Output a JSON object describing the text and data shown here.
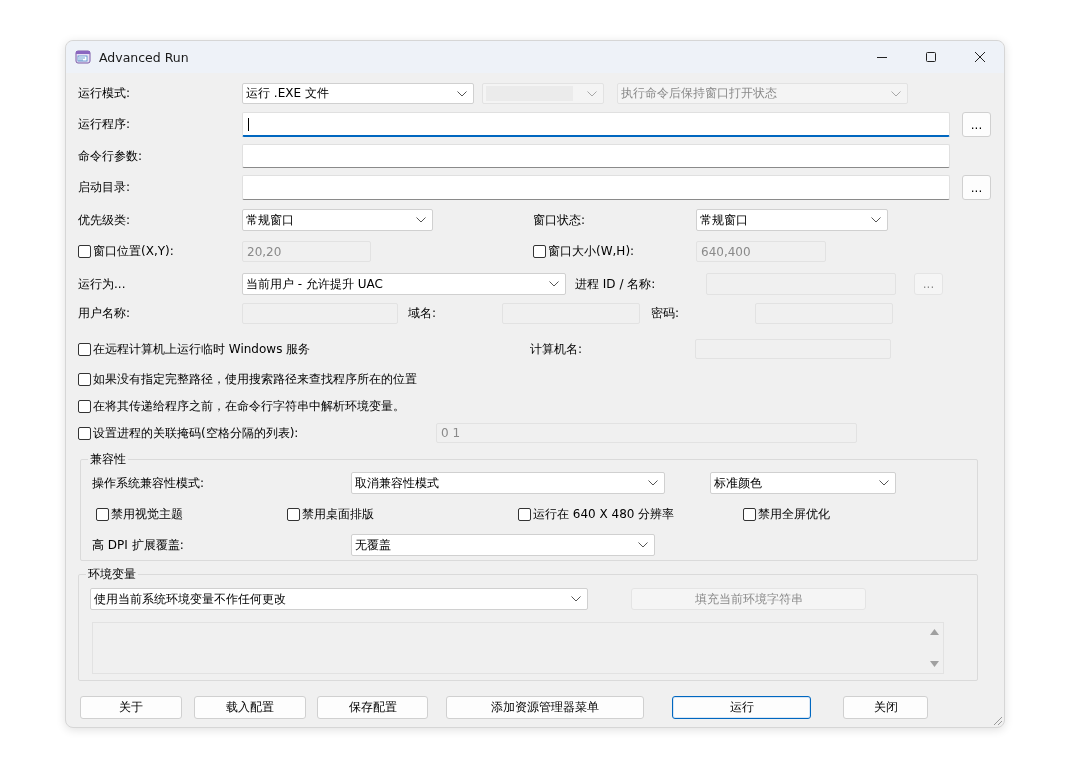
{
  "window": {
    "title": "Advanced Run"
  },
  "run_mode": {
    "label": "运行模式:",
    "mode": {
      "value": "运行 .EXE 文件",
      "disabled": false
    },
    "secondary": {
      "disabled": true
    },
    "window_option": {
      "value": "执行命令后保持窗口打开状态",
      "disabled": true
    }
  },
  "program": {
    "label": "运行程序:",
    "focused": true,
    "disabled": false,
    "browse": {
      "label": "...",
      "disabled": false
    }
  },
  "arguments": {
    "label": "命令行参数:",
    "focused": false,
    "disabled": false
  },
  "start_directory": {
    "label": "启动目录:",
    "focused": false,
    "disabled": false,
    "browse": {
      "label": "...",
      "disabled": false
    }
  },
  "priority": {
    "label": "优先级类:",
    "value": "常规窗口",
    "disabled": false
  },
  "window_state": {
    "label": "窗口状态:",
    "value": "常规窗口",
    "disabled": false
  },
  "window_position": {
    "label": "窗口位置(X,Y):",
    "checked": false,
    "value": "20,20",
    "disabled": true
  },
  "window_size": {
    "label": "窗口大小(W,H):",
    "checked": false,
    "value": "640,400",
    "disabled": true
  },
  "run_as": {
    "label": "运行为...",
    "value": "当前用户 - 允许提升 UAC",
    "disabled": false
  },
  "process": {
    "label": "进程 ID / 名称:",
    "disabled": true,
    "browse": {
      "label": "...",
      "disabled": true
    }
  },
  "user_name": {
    "label": "用户名称:",
    "disabled": true
  },
  "domain": {
    "label": "域名:",
    "disabled": true
  },
  "password": {
    "label": "密码:",
    "disabled": true
  },
  "options": [
    {
      "label": "在远程计算机上运行临时 Windows 服务",
      "checked": false
    },
    {
      "label": "如果没有指定完整路径，使用搜索路径来查找程序所在的位置",
      "checked": false
    },
    {
      "label": "在将其传递给程序之前，在命令行字符串中解析环境变量。",
      "checked": false
    },
    {
      "label": "设置进程的关联掩码(空格分隔的列表):",
      "checked": false
    }
  ],
  "computer_name": {
    "label": "计算机名:",
    "disabled": true
  },
  "affinity": {
    "value": "0 1",
    "disabled": true
  },
  "compatibility": {
    "title": "兼容性",
    "os_mode": {
      "label": "操作系统兼容性模式:",
      "value": "取消兼容性模式",
      "disabled": false
    },
    "color": {
      "value": "标准颜色",
      "disabled": false
    },
    "options": [
      {
        "label": "禁用视觉主题",
        "checked": false
      },
      {
        "label": "禁用桌面排版",
        "checked": false
      },
      {
        "label": "运行在 640 X 480 分辨率",
        "checked": false
      },
      {
        "label": "禁用全屏优化",
        "checked": false
      }
    ],
    "high_dpi": {
      "label": "高 DPI 扩展覆盖:",
      "value": "无覆盖",
      "disabled": false
    }
  },
  "environment": {
    "title": "环境变量",
    "mode": {
      "value": "使用当前系统环境变量不作任何更改",
      "disabled": false
    },
    "fill_button": {
      "label": "填充当前环境字符串",
      "disabled": true
    }
  },
  "buttons": [
    {
      "label": "关于",
      "default": false
    },
    {
      "label": "载入配置",
      "default": false
    },
    {
      "label": "保存配置",
      "default": false
    },
    {
      "label": "添加资源管理器菜单",
      "default": false
    },
    {
      "label": "运行",
      "default": true
    },
    {
      "label": "关闭",
      "default": false
    }
  ]
}
